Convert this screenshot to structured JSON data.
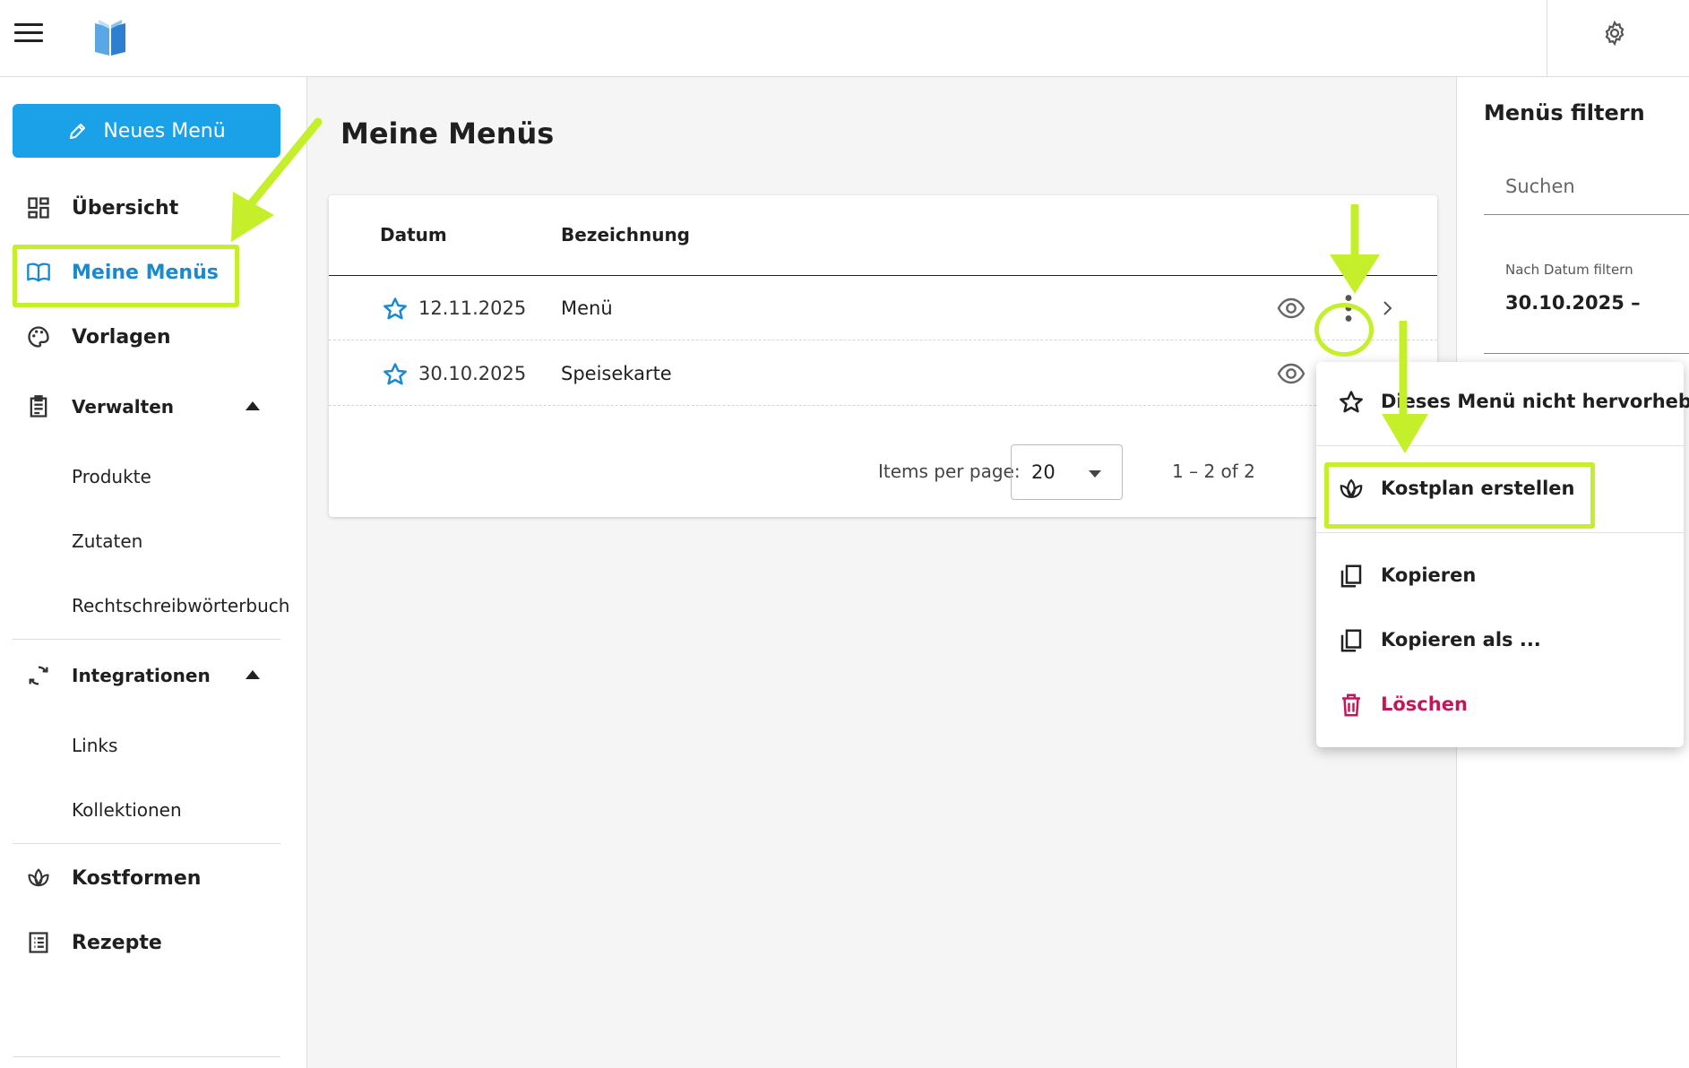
{
  "topbar": {
    "menu_icon": "hamburger-icon",
    "logo_icon": "book-logo-icon",
    "settings_icon": "gear-icon"
  },
  "sidebar": {
    "new_button_label": "Neues Menü",
    "items": [
      {
        "label": "Übersicht",
        "icon": "dashboard-icon"
      },
      {
        "label": "Meine Menüs",
        "icon": "open-book-icon",
        "active": true
      },
      {
        "label": "Vorlagen",
        "icon": "palette-icon"
      },
      {
        "label": "Verwalten",
        "icon": "clipboard-icon",
        "expanded": true
      },
      {
        "label": "Integrationen",
        "icon": "sync-icon",
        "expanded": true
      },
      {
        "label": "Kostformen",
        "icon": "lotus-icon"
      },
      {
        "label": "Rezepte",
        "icon": "list-icon"
      }
    ],
    "verwalten_sub": [
      "Produkte",
      "Zutaten",
      "Rechtschreibwörterbuch"
    ],
    "integrationen_sub": [
      "Links",
      "Kollektionen"
    ]
  },
  "main": {
    "title": "Meine Menüs",
    "columns": [
      "Datum",
      "Bezeichnung"
    ],
    "rows": [
      {
        "date": "12.11.2025",
        "name": "Menü"
      },
      {
        "date": "30.10.2025",
        "name": "Speisekarte"
      }
    ],
    "pager": {
      "label": "Items per page:",
      "value": "20",
      "range": "1 – 2 of 2"
    }
  },
  "filter": {
    "title": "Menüs filtern",
    "search_placeholder": "Suchen",
    "date_label": "Nach Datum filtern",
    "date_value": "30.10.2025 –"
  },
  "context_menu": {
    "items": [
      {
        "label": "Dieses Menü nicht hervorheben",
        "icon": "star-outline-icon"
      },
      {
        "label": "Kostplan erstellen",
        "icon": "lotus-icon"
      },
      {
        "label": "Kopieren",
        "icon": "copy-icon"
      },
      {
        "label": "Kopieren als ...",
        "icon": "copy-icon"
      },
      {
        "label": "Löschen",
        "icon": "trash-icon",
        "danger": true
      }
    ]
  },
  "colors": {
    "accent": "#1aa1e8",
    "highlight": "#c6ef2b",
    "danger": "#c2185b",
    "star": "#1a8ad0"
  }
}
